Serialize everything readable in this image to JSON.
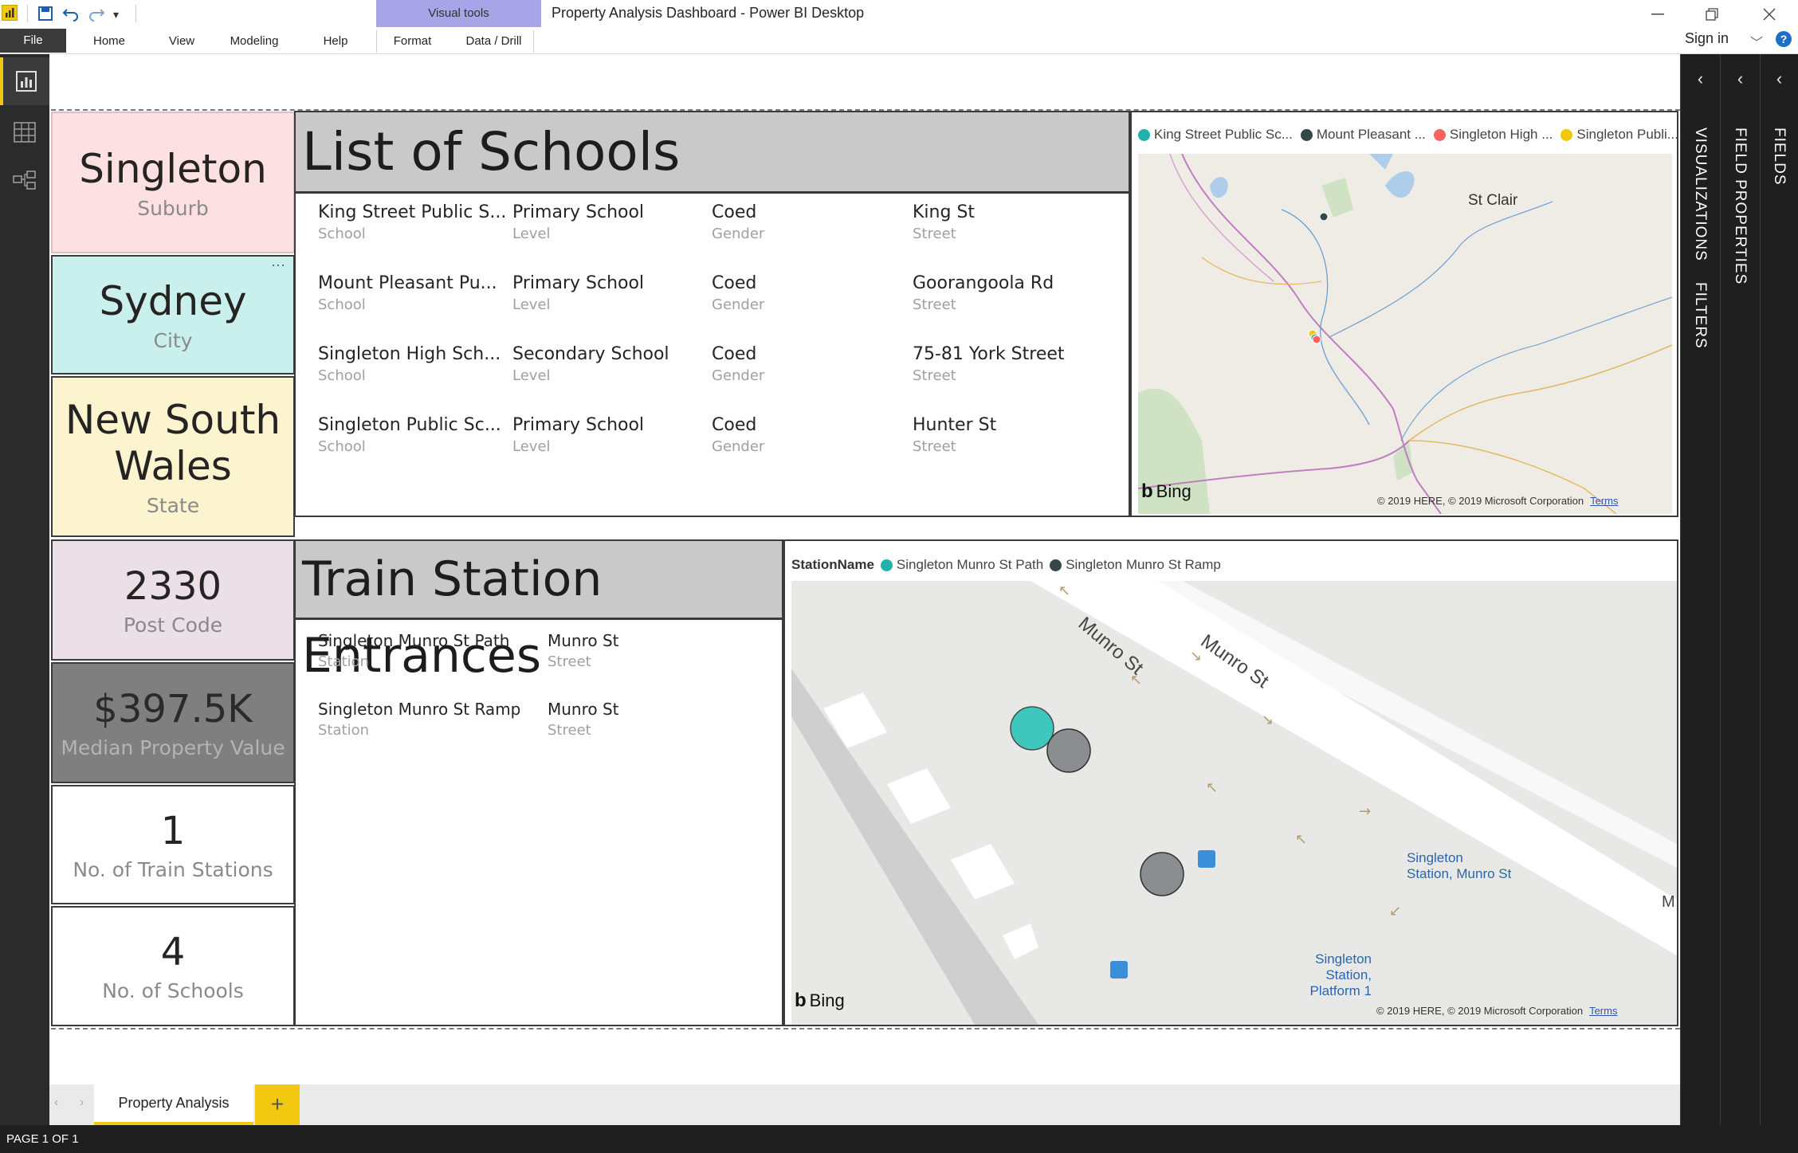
{
  "app": {
    "window_title": "Property Analysis Dashboard - Power BI Desktop",
    "contextual_tab_header": "Visual tools",
    "sign_in": "Sign in",
    "help_glyph": "?"
  },
  "ribbon": {
    "file": "File",
    "tabs": [
      "Home",
      "View",
      "Modeling",
      "Help",
      "Format",
      "Data / Drill"
    ]
  },
  "side_panes": {
    "visualizations": "VISUALIZATIONS",
    "filters": "FILTERS",
    "field_properties": "FIELD PROPERTIES",
    "fields": "FIELDS"
  },
  "cards": [
    {
      "value": "Singleton",
      "label": "Suburb",
      "color": "#fde0e2"
    },
    {
      "value": "Sydney",
      "label": "City",
      "color": "#c9f0ec"
    },
    {
      "value": "New South Wales",
      "label": "State",
      "color": "#fbf4cf"
    },
    {
      "value": "2330",
      "label": "Post Code",
      "color": "#ebdfe8"
    },
    {
      "value": "$397.5K",
      "label": "Median Property Value",
      "color": "#7f7f7f"
    },
    {
      "value": "1",
      "label": "No. of Train Stations",
      "color": "#ffffff"
    },
    {
      "value": "4",
      "label": "No. of Schools",
      "color": "#ffffff"
    }
  ],
  "card_more_glyph": "···",
  "schools": {
    "title": "List of Schools",
    "field_labels": [
      "School",
      "Level",
      "Gender",
      "Street"
    ],
    "rows": [
      [
        "King Street Public S...",
        "Primary School",
        "Coed",
        "King St"
      ],
      [
        "Mount Pleasant Pu...",
        "Primary School",
        "Coed",
        "Goorangoola Rd"
      ],
      [
        "Singleton High Sch...",
        "Secondary School",
        "Coed",
        "75-81 York Street"
      ],
      [
        "Singleton Public Sc...",
        "Primary School",
        "Coed",
        "Hunter St"
      ]
    ]
  },
  "stations": {
    "title": "Train Station Entrances",
    "field_labels": [
      "Station",
      "Street"
    ],
    "rows": [
      [
        "Singleton Munro St Path",
        "Munro St"
      ],
      [
        "Singleton Munro St Ramp",
        "Munro St"
      ]
    ]
  },
  "school_map": {
    "legend": [
      {
        "name": "King Street Public Sc...",
        "color": "#20b2aa"
      },
      {
        "name": "Mount Pleasant ...",
        "color": "#374649"
      },
      {
        "name": "Singleton High ...",
        "color": "#fd625e"
      },
      {
        "name": "Singleton Publi...",
        "color": "#f2c80f"
      }
    ],
    "place_label": "St Clair",
    "bing": "Bing",
    "copyright": "© 2019 HERE, © 2019 Microsoft Corporation",
    "terms": "Terms"
  },
  "station_map": {
    "legend_title": "StationName",
    "legend": [
      {
        "name": "Singleton Munro St Path",
        "color": "#20b2aa"
      },
      {
        "name": "Singleton Munro St Ramp",
        "color": "#374649"
      }
    ],
    "street_label": "Munro St",
    "street_label_2": "Munro St",
    "street_label_edge": "M",
    "poi_station_munro": [
      "Singleton",
      "Station, Munro St"
    ],
    "poi_platform": [
      "Singleton",
      "Station,",
      "Platform 1"
    ],
    "bing": "Bing",
    "copyright": "© 2019 HERE, © 2019 Microsoft Corporation",
    "terms": "Terms"
  },
  "page_tabs": {
    "active": "Property Analysis",
    "add": "+"
  },
  "status": "PAGE 1 OF 1"
}
